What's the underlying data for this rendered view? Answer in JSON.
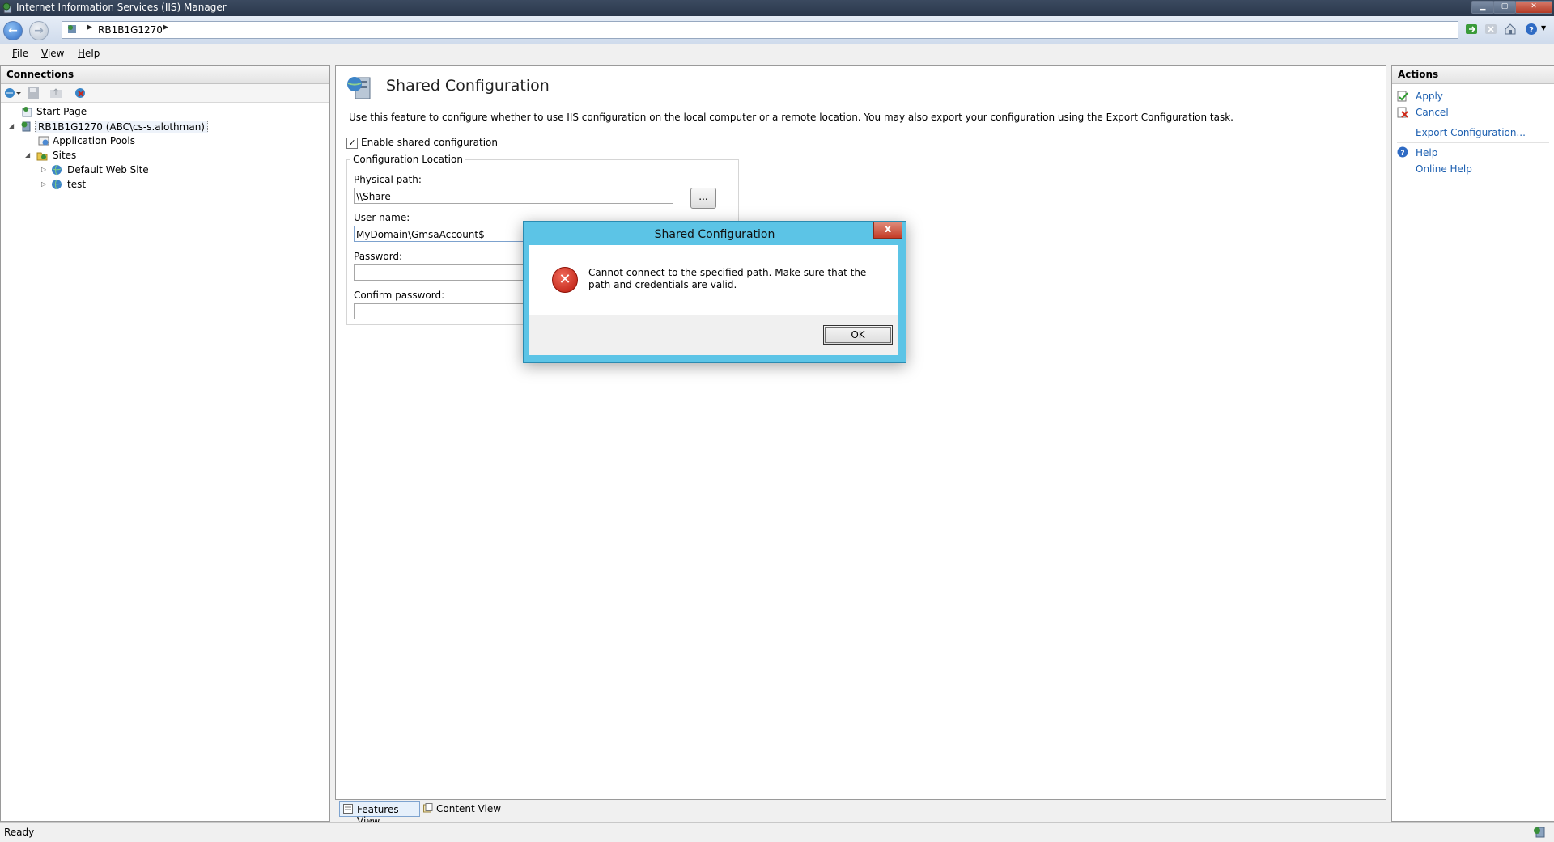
{
  "window": {
    "title": "Internet Information Services (IIS) Manager"
  },
  "navbar": {
    "breadcrumb": "RB1B1G1270"
  },
  "menu": {
    "items": [
      {
        "label": "File",
        "hotkey": "F",
        "rest": "ile"
      },
      {
        "label": "View",
        "hotkey": "V",
        "rest": "iew"
      },
      {
        "label": "Help",
        "hotkey": "H",
        "rest": "elp"
      }
    ]
  },
  "connections": {
    "header": "Connections",
    "tree": {
      "start_page": "Start Page",
      "server": "RB1B1G1270 (ABC\\cs-s.alothman)",
      "app_pools": "Application Pools",
      "sites": "Sites",
      "default_site": "Default Web Site",
      "test_site": "test"
    }
  },
  "content": {
    "title": "Shared Configuration",
    "description": "Use this feature to configure whether to use IIS configuration on the local computer or a remote location. You may also export your configuration using the Export Configuration task.",
    "enable_label": "Enable shared configuration",
    "enable_checked": true,
    "group_title": "Configuration Location",
    "physical_path_label": "Physical path:",
    "physical_path_value": "\\\\Share",
    "browse_label": "...",
    "username_label": "User name:",
    "username_value": "MyDomain\\GmsaAccount$",
    "password_label": "Password:",
    "password_value": "",
    "confirm_label": "Confirm password:",
    "confirm_value": ""
  },
  "actions": {
    "header": "Actions",
    "apply": "Apply",
    "cancel": "Cancel",
    "export": "Export Configuration...",
    "help": "Help",
    "online_help": "Online Help"
  },
  "tabs": {
    "features_view": "Features View",
    "content_view": "Content View"
  },
  "dialog": {
    "title": "Shared Configuration",
    "message": "Cannot connect to the specified path. Make sure that the path and credentials are valid.",
    "ok": "OK",
    "close_glyph": "x"
  },
  "status": {
    "text": "Ready"
  },
  "colors": {
    "accent_link": "#1c5fb0",
    "dialog_frame": "#5cc4e6",
    "error_red": "#c8261a"
  }
}
